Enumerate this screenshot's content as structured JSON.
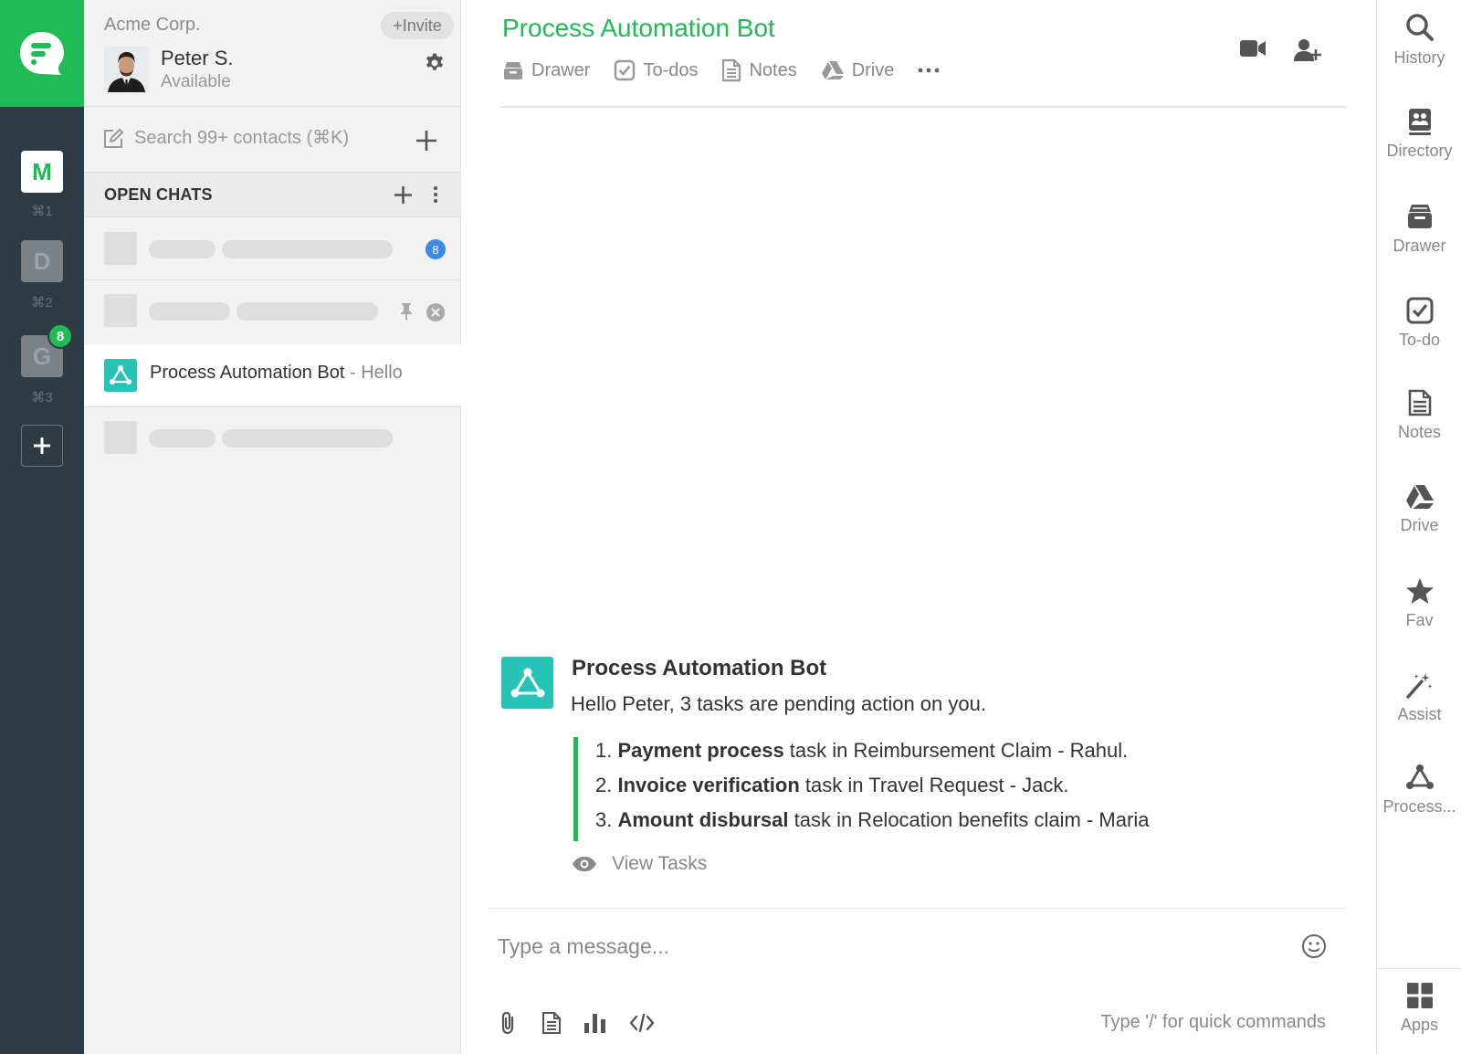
{
  "colors": {
    "brand": "#1fbb54",
    "rail": "#2f3b44",
    "bot": "#27c3b6",
    "unread_badge": "#3d8ae5"
  },
  "rail": {
    "logo_icon": "flock-logo-icon",
    "orgs": [
      {
        "letter": "M",
        "shortcut": "⌘1"
      },
      {
        "letter": "D",
        "shortcut": "⌘2"
      },
      {
        "letter": "G",
        "shortcut": "⌘3",
        "badge": "8"
      }
    ],
    "add_icon": "plus-icon"
  },
  "account": {
    "company": "Acme Corp.",
    "invite_label": "+Invite",
    "user_name": "Peter S.",
    "user_status": "Available"
  },
  "search": {
    "placeholder": "Search 99+ contacts (⌘K)"
  },
  "open_chats": {
    "title": "OPEN CHATS",
    "unread_badge": "8",
    "active": {
      "name": "Process Automation Bot",
      "preview": " - Hello"
    }
  },
  "chat": {
    "title": "Process Automation Bot",
    "tabs": [
      "Drawer",
      "To-dos",
      "Notes",
      "Drive"
    ],
    "more_icon": "more-dots-icon"
  },
  "message": {
    "sender": "Process Automation Bot",
    "text": "Hello Peter, 3 tasks are pending action on you.",
    "items": [
      {
        "num": "1.",
        "bold": "Payment process",
        "rest": " task in Reimbursement Claim - Rahul."
      },
      {
        "num": "2.",
        "bold": "Invoice verification",
        "rest": " task in Travel Request - Jack."
      },
      {
        "num": "3.",
        "bold": "Amount disbursal",
        "rest": " task in Relocation benefits claim - Maria"
      }
    ],
    "view_tasks": "View Tasks"
  },
  "composer": {
    "placeholder": "Type a message...",
    "hint": "Type '/' for quick commands"
  },
  "sidebar_right": {
    "items": [
      "History",
      "Directory",
      "Drawer",
      "To-do",
      "Notes",
      "Drive",
      "Fav",
      "Assist",
      "Process..."
    ],
    "apps": "Apps"
  }
}
